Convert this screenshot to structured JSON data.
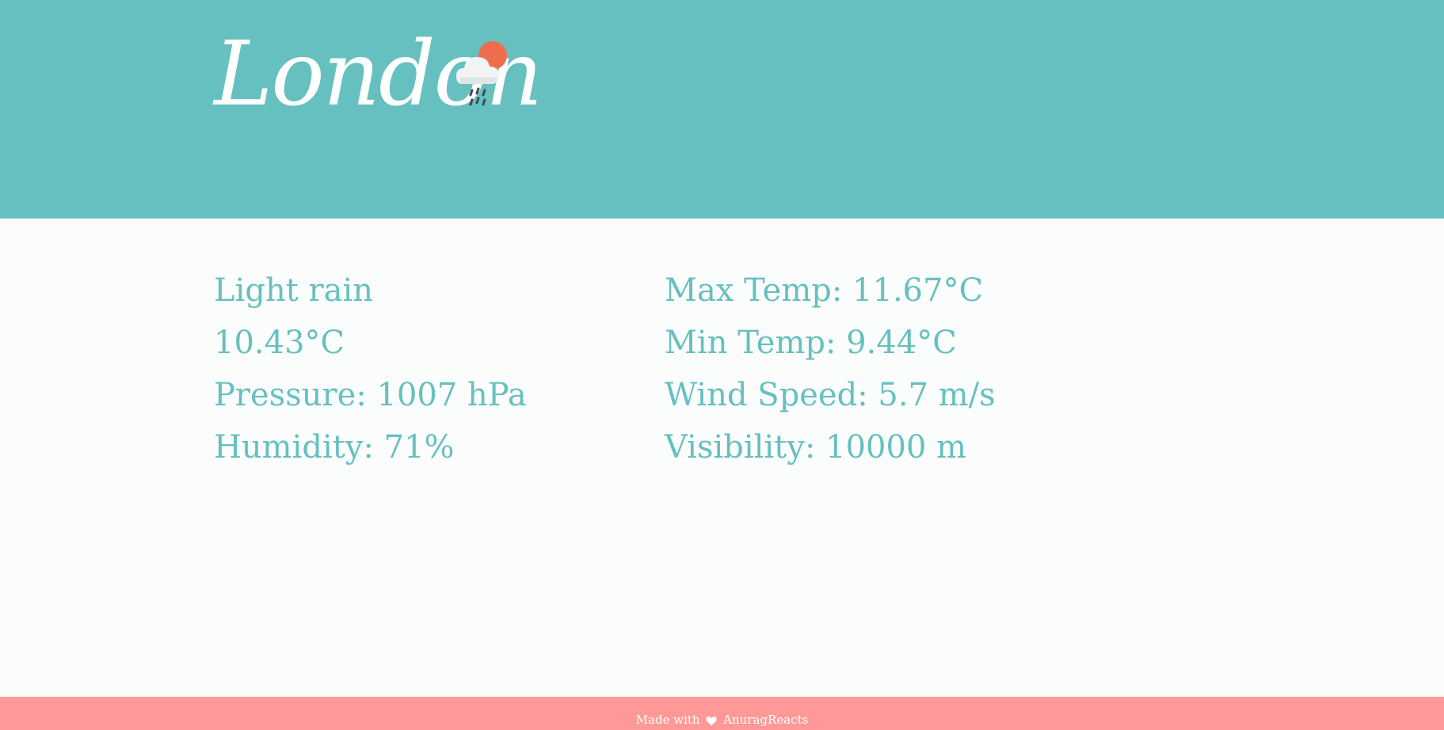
{
  "header": {
    "city": "London",
    "weather_icon": "cloud-rain-sun-icon"
  },
  "weather": {
    "description": "Light rain",
    "temperature": "10.43°C",
    "pressure": "Pressure: 1007 hPa",
    "humidity": "Humidity: 71%",
    "max_temp": "Max Temp: 11.67°C",
    "min_temp": "Min Temp: 9.44°C",
    "wind_speed": "Wind Speed: 5.7 m/s",
    "visibility": "Visibility: 10000 m"
  },
  "footer": {
    "prefix": "Made with",
    "icon": "heart-icon",
    "author": "AnuragReacts"
  },
  "colors": {
    "header_bg": "#67c0c0",
    "text_accent": "#67c0c0",
    "footer_bg": "#ff9998",
    "sun": "#ee6d4d"
  }
}
